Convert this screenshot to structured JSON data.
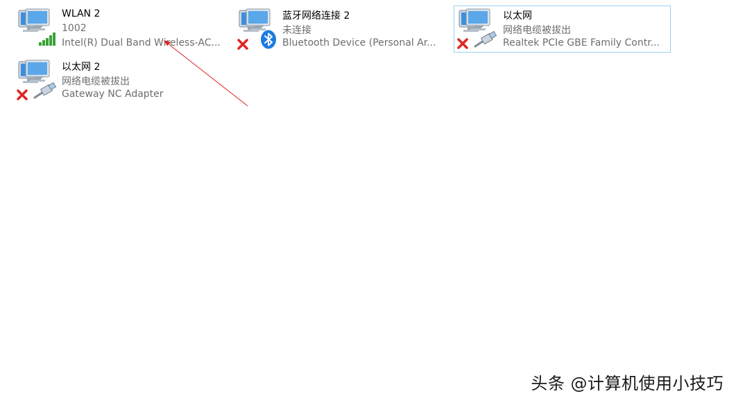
{
  "adapters": [
    {
      "name": "WLAN 2",
      "status": "1002",
      "device": "Intel(R) Dual Band Wireless-AC...",
      "overlay_icon": "wifi-signal-icon",
      "selected": false
    },
    {
      "name": "蓝牙网络连接 2",
      "status": "未连接",
      "device": "Bluetooth Device (Personal Ar...",
      "overlay_icon": "bluetooth-icon",
      "disconnected": true,
      "selected": false
    },
    {
      "name": "以太网",
      "status": "网络电缆被拔出",
      "device": "Realtek PCIe GBE Family Contr...",
      "overlay_icon": "ethernet-cable-icon",
      "disconnected": true,
      "selected": true
    },
    {
      "name": "以太网 2",
      "status": "网络电缆被拔出",
      "device": "Gateway NC Adapter",
      "overlay_icon": "ethernet-cable-icon",
      "disconnected": true,
      "selected": false
    }
  ],
  "annotation": {
    "type": "red-arrow",
    "color": "#e02020"
  },
  "watermark": {
    "text": "头条 @计算机使用小技巧"
  },
  "colors": {
    "selection_border": "#99d1f4",
    "secondary_text": "#6d6d6d",
    "signal_green": "#3aa336",
    "bluetooth_blue": "#1e7be0",
    "error_red": "#e02424"
  }
}
